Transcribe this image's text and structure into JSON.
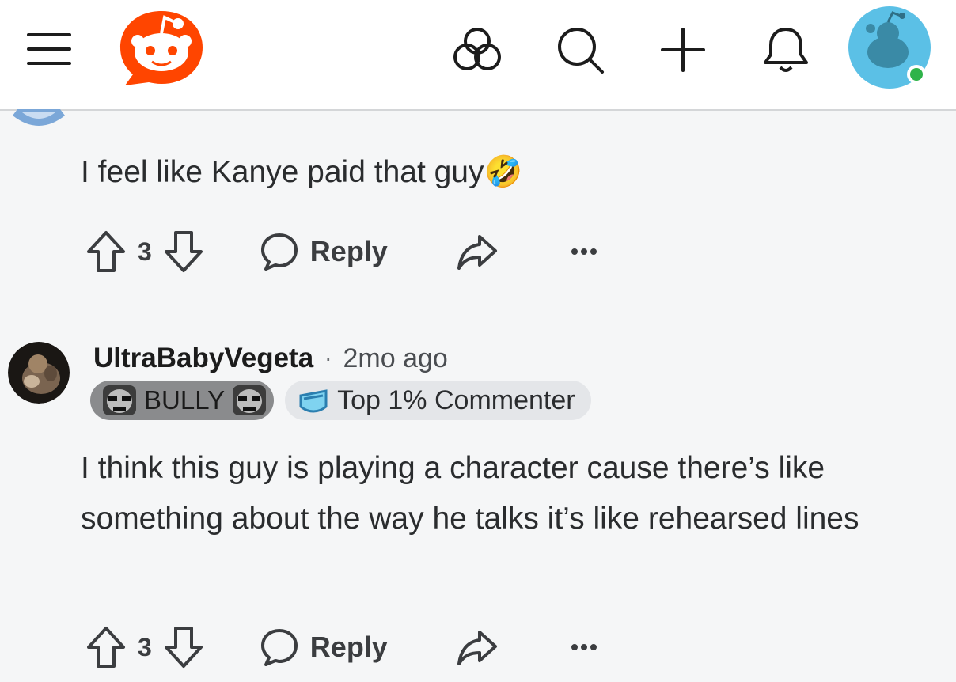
{
  "header": {
    "brand_color": "#ff4500",
    "avatar_bg": "#5bc0e6",
    "online_color": "#2fb34a",
    "icons": [
      "menu-icon",
      "reddit-logo",
      "explore-icon",
      "search-icon",
      "create-icon",
      "notification-icon",
      "user-avatar"
    ]
  },
  "comments": [
    {
      "body": "I feel like Kanye paid that guy🤣",
      "votes": "3",
      "reply_label": "Reply"
    },
    {
      "username": "UltraBabyVegeta",
      "separator": "·",
      "timestamp": "2mo ago",
      "flair": "BULLY",
      "badge": "Top 1% Commenter",
      "body": "I think this guy is playing a character cause there’s like something about the way he talks it’s like rehearsed lines",
      "votes": "3",
      "reply_label": "Reply"
    }
  ]
}
